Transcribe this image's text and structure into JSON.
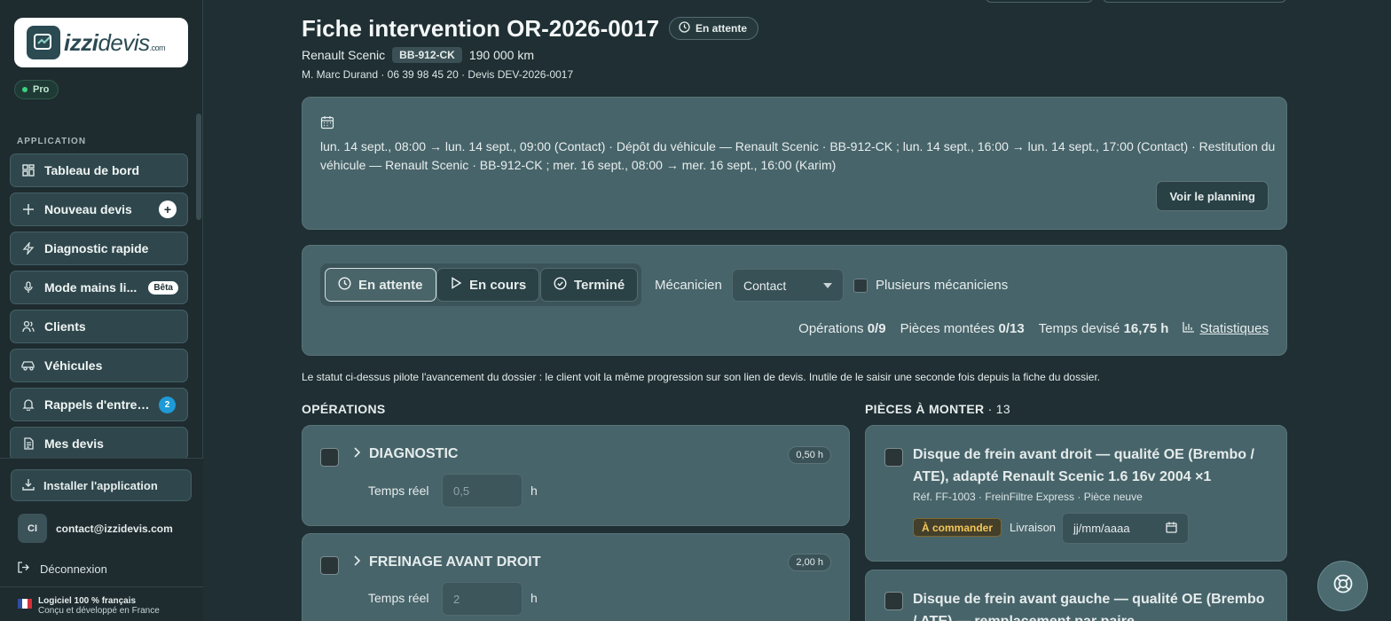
{
  "brand": {
    "logo_strong": "izzi",
    "logo_light": "devis",
    "logo_suffix": ".com",
    "plan_badge": "Pro"
  },
  "sidebar": {
    "section_label": "APPLICATION",
    "items": [
      {
        "label": "Tableau de bord",
        "icon": "dashboard-icon"
      },
      {
        "label": "Nouveau devis",
        "icon": "plus-icon",
        "badge": "+"
      },
      {
        "label": "Diagnostic rapide",
        "icon": "bolt-icon"
      },
      {
        "label": "Mode mains li...",
        "icon": "microphone-icon",
        "badge": "Bêta"
      },
      {
        "label": "Clients",
        "icon": "users-icon"
      },
      {
        "label": "Véhicules",
        "icon": "car-icon"
      },
      {
        "label": "Rappels d'entret...",
        "icon": "bell-icon",
        "badge": "2"
      },
      {
        "label": "Mes devis",
        "icon": "document-icon"
      }
    ],
    "install_label": "Installer l'application",
    "user_initials": "CI",
    "user_email": "contact@izzidevis.com",
    "logout_label": "Déconnexion",
    "footer_line1": "Logiciel 100 % français",
    "footer_line2": "Conçu et développé en France"
  },
  "header": {
    "title": "Fiche intervention OR-2026-0017",
    "status": "En attente",
    "vehicle_model": "Renault Scenic",
    "plate": "BB-912-CK",
    "mileage": "190 000 km",
    "client_line": "M. Marc Durand · 06 39 98 45 20 · Devis DEV-2026-0017"
  },
  "schedule": {
    "text": "lun. 14 sept., 08:00 → lun. 14 sept., 09:00 (Contact) · Dépôt du véhicule — Renault Scenic · BB-912-CK ; lun. 14 sept., 16:00 → lun. 14 sept., 17:00 (Contact) · Restitution du véhicule — Renault Scenic · BB-912-CK ; mer. 16 sept., 08:00 → mer. 16 sept., 16:00 (Karim)",
    "button": "Voir le planning"
  },
  "status_panel": {
    "buttons": [
      "En attente",
      "En cours",
      "Terminé"
    ],
    "mechanic_label": "Mécanicien",
    "mechanic_value": "Contact",
    "multi_label": "Plusieurs mécaniciens",
    "ops_label": "Opérations",
    "ops_value": "0/9",
    "parts_label": "Pièces montées",
    "parts_value": "0/13",
    "time_label": "Temps devisé",
    "time_value": "16,75 h",
    "stats_link": "Statistiques"
  },
  "note": "Le statut ci-dessus pilote l'avancement du dossier : le client voit la même progression sur son lien de devis. Inutile de le saisir une seconde fois depuis la fiche du dossier.",
  "operations": {
    "title": "OPÉRATIONS",
    "items": [
      {
        "name": "DIAGNOSTIC",
        "hours": "0,50 h",
        "time_label": "Temps réel",
        "time_placeholder": "0,5",
        "unit": "h"
      },
      {
        "name": "FREINAGE AVANT DROIT",
        "hours": "2,00 h",
        "time_label": "Temps réel",
        "time_placeholder": "2",
        "unit": "h"
      }
    ]
  },
  "parts": {
    "title": "PIÈCES À MONTER",
    "count": "· 13",
    "items": [
      {
        "name": "Disque de frein avant droit — qualité OE (Brembo / ATE), adapté Renault Scenic 1.6 16v 2004 ×1",
        "meta": "Réf. FF-1003 · FreinFiltre Express · Pièce neuve",
        "status": "À commander",
        "delivery_label": "Livraison",
        "date_placeholder": "jj/mm/aaaa"
      },
      {
        "name": "Disque de frein avant gauche — qualité OE (Brembo / ATE) — remplacement par paire"
      }
    ]
  }
}
